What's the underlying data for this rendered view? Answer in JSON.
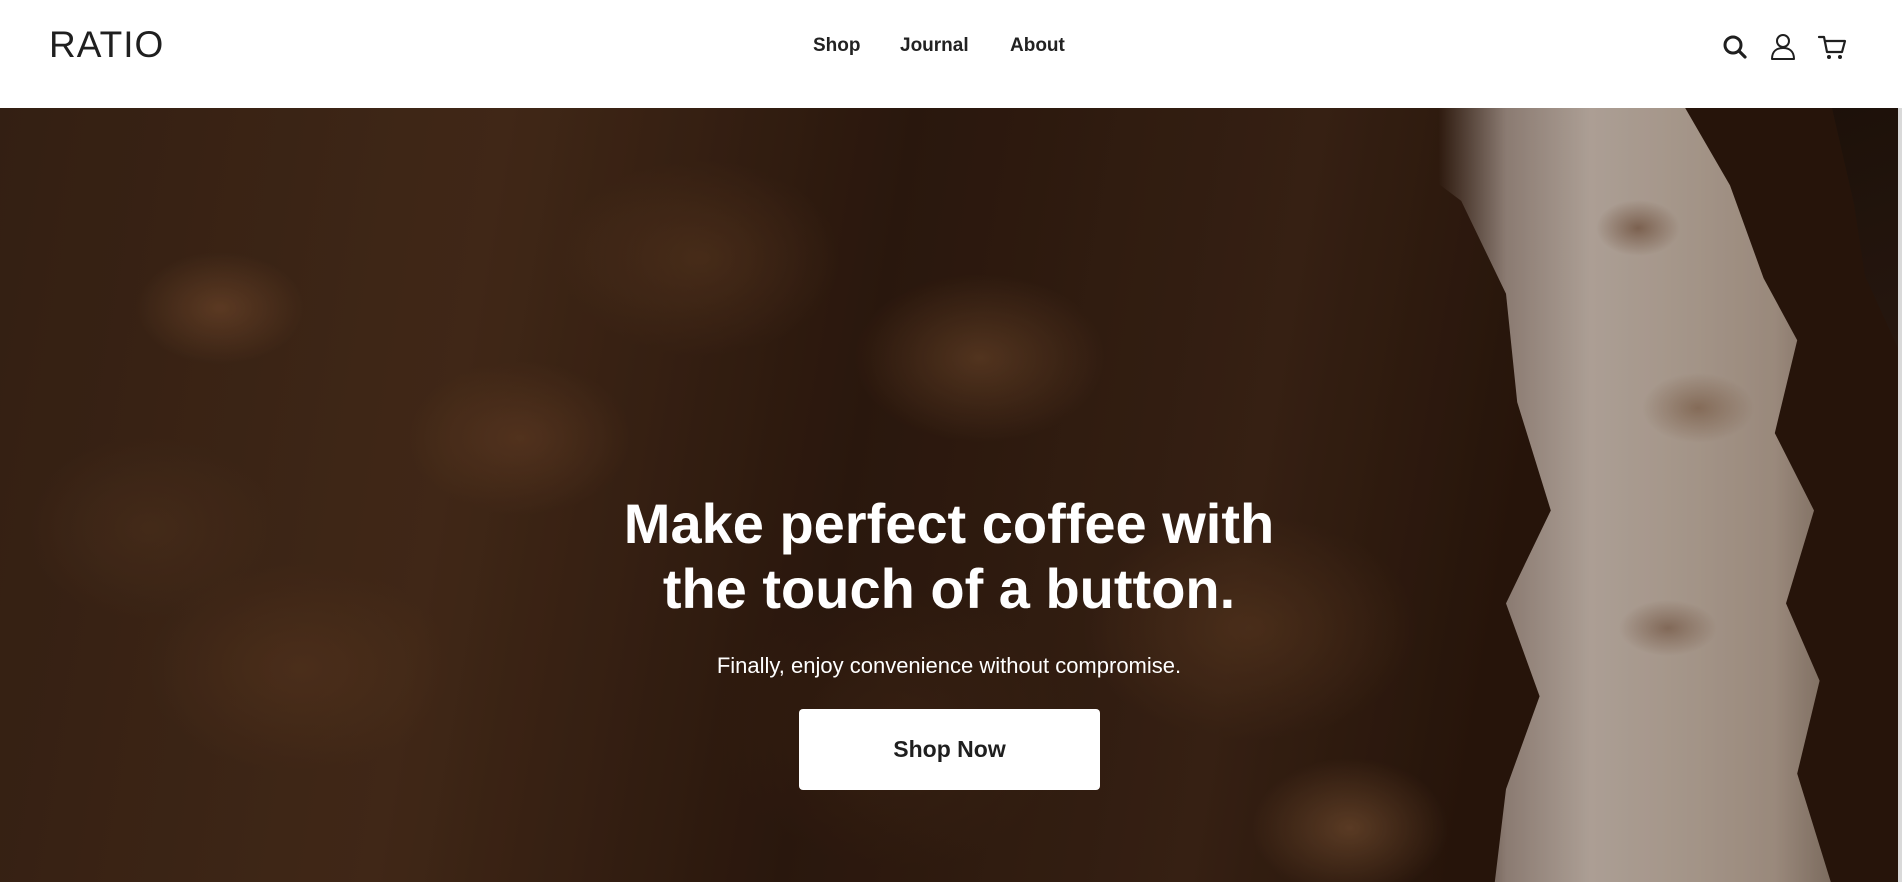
{
  "header": {
    "logo": "RATIO",
    "nav": [
      {
        "label": "Shop"
      },
      {
        "label": "Journal"
      },
      {
        "label": "About"
      }
    ],
    "icons": {
      "search": "search-icon",
      "account": "account-icon",
      "cart": "cart-icon"
    }
  },
  "hero": {
    "title_line1": "Make perfect coffee with",
    "title_line2": "the touch of a button.",
    "subtitle": "Finally, enjoy convenience without compromise.",
    "cta_label": "Shop Now"
  },
  "colors": {
    "text_dark": "#1f1f1f",
    "hero_text": "#ffffff",
    "button_bg": "#ffffff"
  }
}
